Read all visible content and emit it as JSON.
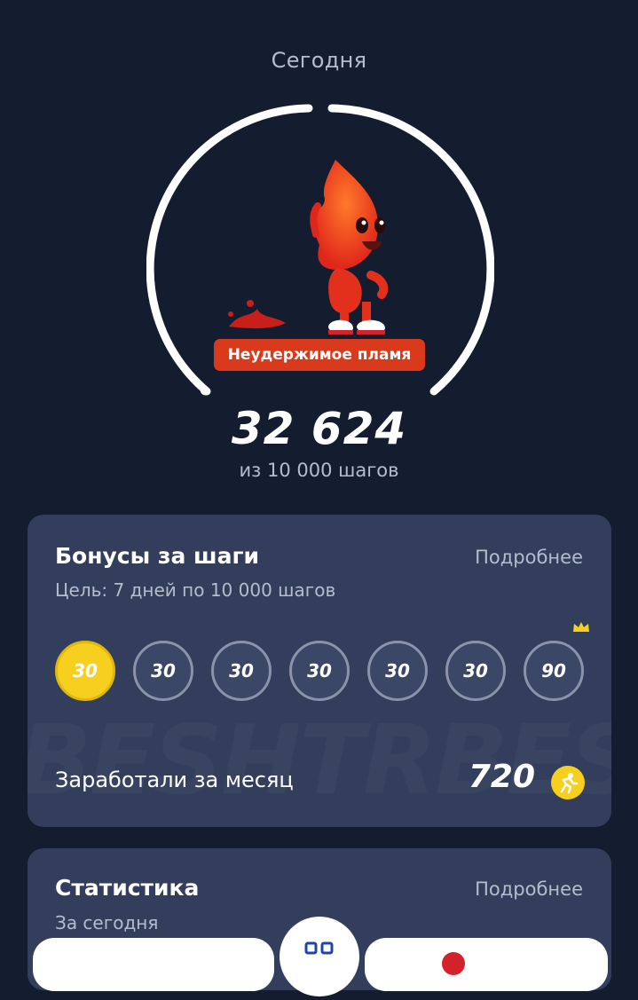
{
  "header": {
    "period": "Сегодня"
  },
  "progress": {
    "badge": "Неудержимое пламя",
    "steps": "32 624",
    "goal_text": "из 10 000 шагов",
    "completion_fraction": 1.0
  },
  "bonuses": {
    "title": "Бонусы за шаги",
    "more_label": "Подробнее",
    "subtitle": "Цель: 7 дней по 10 000 шагов",
    "coins": [
      {
        "value": "30",
        "done": true
      },
      {
        "value": "30",
        "done": false
      },
      {
        "value": "30",
        "done": false
      },
      {
        "value": "30",
        "done": false
      },
      {
        "value": "30",
        "done": false
      },
      {
        "value": "30",
        "done": false
      },
      {
        "value": "90",
        "done": false,
        "crown": true
      }
    ],
    "earned_label": "Заработали за месяц",
    "earned_value": "720"
  },
  "stats": {
    "title": "Статистика",
    "more_label": "Подробнее",
    "subtitle": "За сегодня"
  },
  "colors": {
    "background": "#141c30",
    "card": "#323e5c",
    "coin_gold": "#f6cf1f",
    "badge_red": "#d93a1c",
    "muted_text": "#b5bccb"
  },
  "icons": {
    "mascot": "flame-mascot-icon",
    "crown": "crown-icon",
    "earned_coin": "runner-coin-icon",
    "nav_center": "grid-icon"
  }
}
